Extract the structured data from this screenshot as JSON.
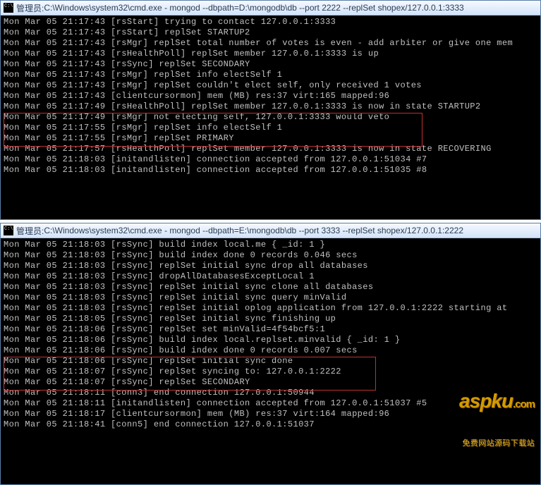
{
  "top": {
    "title_prefix": "管理员: ",
    "title_path": "C:\\Windows\\system32\\cmd.exe - mongod  --dbpath=D:\\mongodb\\db --port 2222 --replSet shopex/127.0.0.1:3333",
    "lines": [
      "Mon Mar 05 21:17:43 [rsStart] trying to contact 127.0.0.1:3333",
      "Mon Mar 05 21:17:43 [rsStart] replSet STARTUP2",
      "Mon Mar 05 21:17:43 [rsMgr] replSet total number of votes is even - add arbiter or give one mem",
      "Mon Mar 05 21:17:43 [rsHealthPoll] replSet member 127.0.0.1:3333 is up",
      "Mon Mar 05 21:17:43 [rsSync] replSet SECONDARY",
      "Mon Mar 05 21:17:43 [rsMgr] replSet info electSelf 1",
      "Mon Mar 05 21:17:43 [rsMgr] replSet couldn't elect self, only received 1 votes",
      "Mon Mar 05 21:17:43 [clientcursormon] mem (MB) res:37 virt:165 mapped:96",
      "Mon Mar 05 21:17:49 [rsHealthPoll] replSet member 127.0.0.1:3333 is now in state STARTUP2",
      "Mon Mar 05 21:17:49 [rsMgr] not electing self, 127.0.0.1:3333 would veto",
      "Mon Mar 05 21:17:55 [rsMgr] replSet info electSelf 1",
      "Mon Mar 05 21:17:55 [rsMgr] replSet PRIMARY",
      "Mon Mar 05 21:17:57 [rsHealthPoll] replSet member 127.0.0.1:3333 is now in state RECOVERING",
      "Mon Mar 05 21:18:03 [initandlisten] connection accepted from 127.0.0.1:51034 #7",
      "Mon Mar 05 21:18:03 [initandlisten] connection accepted from 127.0.0.1:51035 #8"
    ]
  },
  "bottom": {
    "title_prefix": "管理员: ",
    "title_path": "C:\\Windows\\system32\\cmd.exe - mongod  --dbpath=E:\\mongodb\\db --port 3333 --replSet shopex/127.0.0.1:2222",
    "lines": [
      "Mon Mar 05 21:18:03 [rsSync] build index local.me { _id: 1 }",
      "Mon Mar 05 21:18:03 [rsSync] build index done 0 records 0.046 secs",
      "Mon Mar 05 21:18:03 [rsSync] replSet initial sync drop all databases",
      "Mon Mar 05 21:18:03 [rsSync] dropAllDatabasesExceptLocal 1",
      "Mon Mar 05 21:18:03 [rsSync] replSet initial sync clone all databases",
      "Mon Mar 05 21:18:03 [rsSync] replSet initial sync query minValid",
      "Mon Mar 05 21:18:03 [rsSync] replSet initial oplog application from 127.0.0.1:2222 starting at",
      "Mon Mar 05 21:18:05 [rsSync] replSet initial sync finishing up",
      "Mon Mar 05 21:18:06 [rsSync] replSet set minValid=4f54bcf5:1",
      "Mon Mar 05 21:18:06 [rsSync] build index local.replset.minvalid { _id: 1 }",
      "Mon Mar 05 21:18:06 [rsSync] build index done 0 records 0.007 secs",
      "Mon Mar 05 21:18:06 [rsSync] replSet initial sync done",
      "Mon Mar 05 21:18:07 [rsSync] replSet syncing to: 127.0.0.1:2222",
      "Mon Mar 05 21:18:07 [rsSync] replSet SECONDARY",
      "Mon Mar 05 21:18:11 [conn3] end connection 127.0.0.1:50944",
      "Mon Mar 05 21:18:11 [initandlisten] connection accepted from 127.0.0.1:51037 #5",
      "Mon Mar 05 21:18:17 [clientcursormon] mem (MB) res:37 virt:164 mapped:96",
      "Mon Mar 05 21:18:41 [conn5] end connection 127.0.0.1:51037"
    ]
  },
  "watermark": {
    "brand": "aspku",
    "suffix": ".com",
    "subtitle": "免费网站源码下载站"
  }
}
